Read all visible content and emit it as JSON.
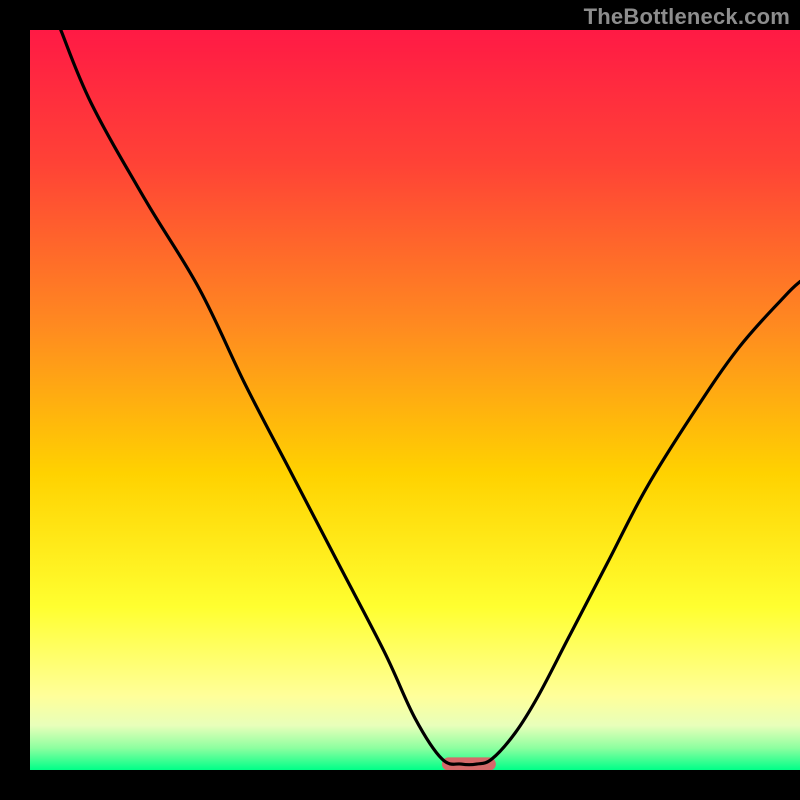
{
  "watermark": "TheBottleneck.com",
  "chart_data": {
    "type": "line",
    "title": "",
    "xlabel": "",
    "ylabel": "",
    "xlim": [
      0,
      100
    ],
    "ylim": [
      0,
      100
    ],
    "background_gradient": {
      "stops": [
        {
          "offset": 0.0,
          "color": "#ff1a45"
        },
        {
          "offset": 0.18,
          "color": "#ff4236"
        },
        {
          "offset": 0.4,
          "color": "#ff8a20"
        },
        {
          "offset": 0.6,
          "color": "#ffd200"
        },
        {
          "offset": 0.78,
          "color": "#ffff30"
        },
        {
          "offset": 0.9,
          "color": "#ffff9a"
        },
        {
          "offset": 0.94,
          "color": "#e8ffba"
        },
        {
          "offset": 0.97,
          "color": "#8effa0"
        },
        {
          "offset": 1.0,
          "color": "#00ff88"
        }
      ]
    },
    "series": [
      {
        "name": "bottleneck-curve",
        "color": "#000000",
        "x": [
          4,
          8,
          15,
          22,
          28,
          34,
          40,
          46,
          50,
          53.5,
          56,
          58,
          60,
          63,
          66,
          70,
          75,
          80,
          86,
          92,
          98,
          100
        ],
        "y": [
          100,
          90,
          77,
          65,
          52,
          40,
          28,
          16,
          7,
          1.5,
          0.8,
          0.8,
          1.5,
          5,
          10,
          18,
          28,
          38,
          48,
          57,
          64,
          66
        ]
      }
    ],
    "marker": {
      "name": "optimal-region",
      "x": 57,
      "y": 0.8,
      "width": 7,
      "height": 1.8,
      "color": "#d56a6a"
    }
  }
}
